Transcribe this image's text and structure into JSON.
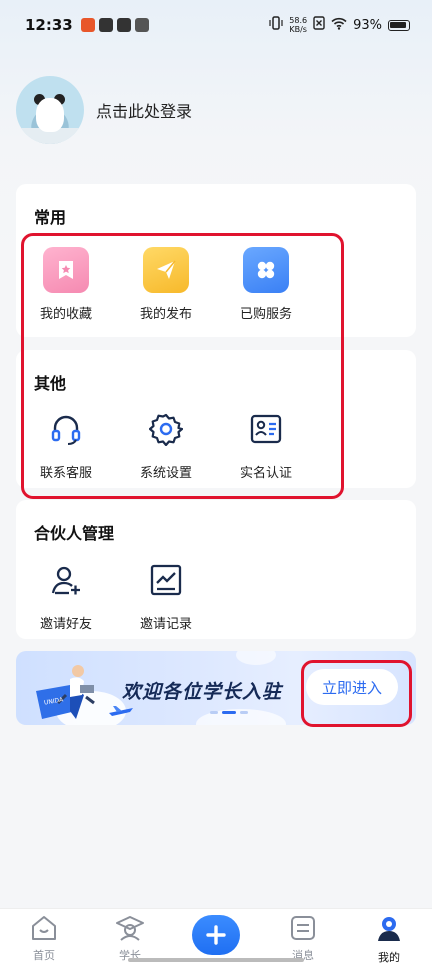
{
  "status_bar": {
    "time": "12:33",
    "net_speed_value": "58.6",
    "net_speed_unit": "KB/s",
    "battery": "93%"
  },
  "profile": {
    "login_prompt": "点击此处登录"
  },
  "common": {
    "title": "常用",
    "items": [
      {
        "label": "我的收藏",
        "icon": "favorites-icon"
      },
      {
        "label": "我的发布",
        "icon": "paper-plane-icon"
      },
      {
        "label": "已购服务",
        "icon": "purchased-services-icon"
      }
    ]
  },
  "other": {
    "title": "其他",
    "items": [
      {
        "label": "联系客服",
        "icon": "headset-icon"
      },
      {
        "label": "系统设置",
        "icon": "gear-icon"
      },
      {
        "label": "实名认证",
        "icon": "id-card-icon"
      }
    ]
  },
  "partner": {
    "title": "合伙人管理",
    "items": [
      {
        "label": "邀请好友",
        "icon": "add-user-icon"
      },
      {
        "label": "邀请记录",
        "icon": "chart-record-icon"
      }
    ]
  },
  "banner": {
    "title": "欢迎各位学长入驻",
    "button": "立即进入",
    "book_label": "UNIDA"
  },
  "bottom_nav": {
    "items": [
      {
        "label": "首页",
        "icon": "home-icon"
      },
      {
        "label": "学长",
        "icon": "graduate-icon"
      },
      {
        "label": "",
        "icon": "plus-icon"
      },
      {
        "label": "消息",
        "icon": "message-icon"
      },
      {
        "label": "我的",
        "icon": "profile-icon"
      }
    ],
    "active": "我的"
  },
  "colors": {
    "accent": "#2c6bf0",
    "annotation": "#e0132e"
  }
}
